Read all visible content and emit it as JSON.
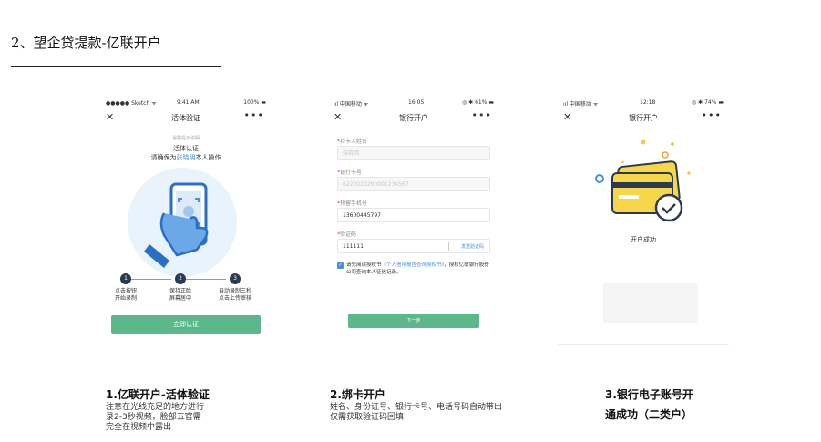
{
  "heading": "2、望企贷提款-亿联开户",
  "phone1": {
    "status": {
      "carrier": "●●●●● Sketch ᯤ",
      "time": "9:41 AM",
      "battery": "100% ▬"
    },
    "nav": {
      "close": "✕",
      "title": "活体验证",
      "more": "•••"
    },
    "hint": "温馨提示说明",
    "line1": "活体认证",
    "line2_prefix": "请确保为",
    "line2_name": "张晓明",
    "line2_suffix": "本人操作",
    "steps": [
      {
        "num": "1",
        "label1": "点击按钮",
        "label2": "开始录制"
      },
      {
        "num": "2",
        "label1": "保持正脸",
        "label2": "屏幕居中"
      },
      {
        "num": "3",
        "label1": "自动录制三秒",
        "label2": "点击上传审核"
      }
    ],
    "button": "立即认证"
  },
  "phone2": {
    "status": {
      "carrier": "ııl 中国移动 ᯤ",
      "time": "16:05",
      "battery": "◎ ✱ 61% ▬"
    },
    "nav": {
      "close": "✕",
      "title": "银行开户",
      "more": "•••"
    },
    "fields": [
      {
        "label": "持卡人姓名",
        "value": "张晓明",
        "gray": true
      },
      {
        "label": "银行卡号",
        "value": "6222020200001234567",
        "gray": true
      },
      {
        "label": "预留手机号",
        "value": "13600445797",
        "gray": false
      },
      {
        "label": "验证码",
        "value": "111111",
        "gray": false
      }
    ],
    "send_code": "发送验证码",
    "agree_prefix": "请先阅读授权书",
    "agree_link": "《个人信用报告查询授权书》",
    "agree_suffix": "，授权亿联银行股份公司查询本人征信记录。",
    "button": "下一步"
  },
  "phone3": {
    "status": {
      "carrier": "ııl 中国移动 ᯤ",
      "time": "12:18",
      "battery": "◎ ✱ 74% ▬"
    },
    "nav": {
      "close": "✕",
      "title": "银行开户",
      "more": "•••"
    },
    "success": "开户成功"
  },
  "captions": [
    {
      "title": "1.亿联开户-活体验证",
      "body": [
        "注意在光线充足的地方进行",
        "录2-3秒视频，脸部五官需",
        "完全在视频中露出"
      ]
    },
    {
      "title": "2.绑卡开户",
      "body": [
        "姓名、身份证号、银行卡号、电话号码自动带出",
        "仅需获取验证码回填"
      ]
    },
    {
      "title_line1": "3.银行电子账号开",
      "title_line2": "通成功（二类户）"
    }
  ],
  "colors": {
    "green": "#5cb88a",
    "blue": "#4a90d9",
    "yellow": "#f7d64a"
  }
}
